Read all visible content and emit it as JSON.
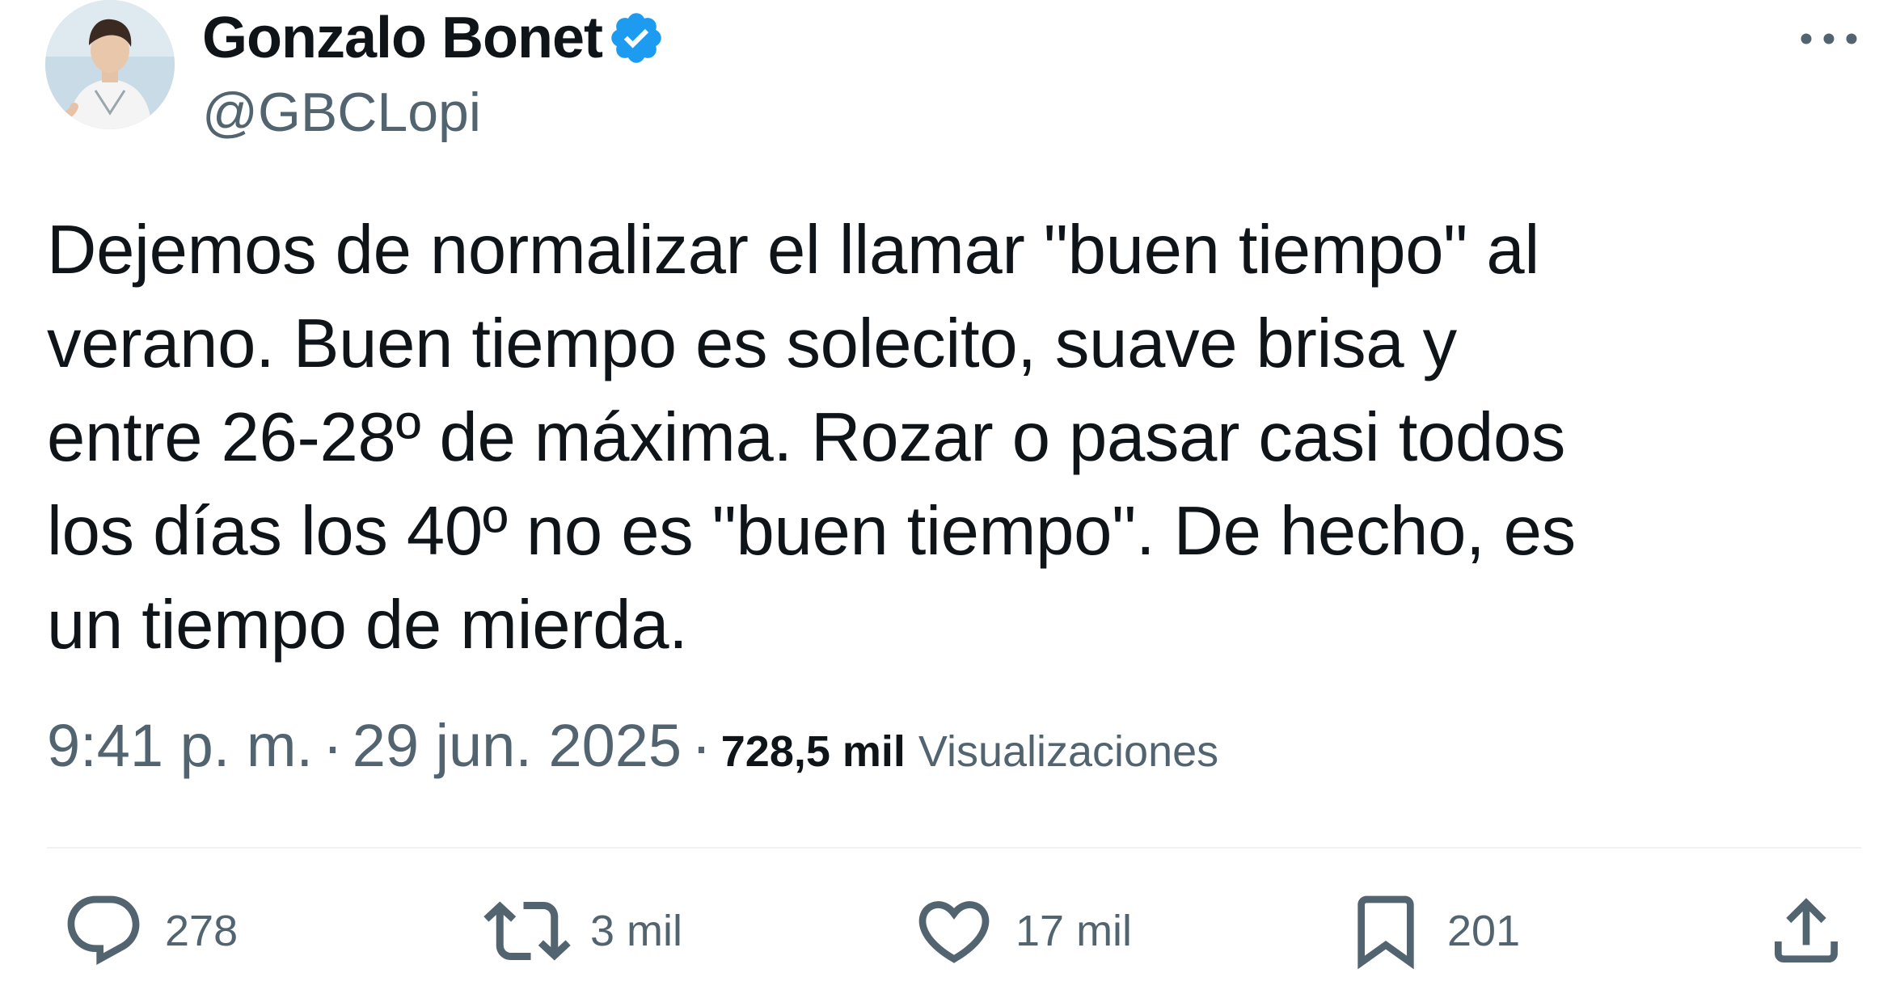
{
  "author": {
    "display_name": "Gonzalo Bonet",
    "handle": "@GBCLopi",
    "verified": true,
    "avatar_icon": "profile-photo",
    "verified_color": "#1d9bf0"
  },
  "tweet": {
    "text": "Dejemos de normalizar el llamar \"buen tiempo\" al\nverano. Buen tiempo es solecito, suave brisa y\nentre 26-28º de máxima. Rozar o pasar casi todos\nlos días los 40º no es \"buen tiempo\". De hecho, es\nun tiempo de mierda.",
    "time": "9:41 p. m.",
    "date": "29 jun. 2025",
    "separator": "·",
    "views_count": "728,5 mil",
    "views_label": "Visualizaciones"
  },
  "actions": {
    "reply": {
      "icon": "reply-icon",
      "count": "278"
    },
    "retweet": {
      "icon": "retweet-icon",
      "count": "3 mil"
    },
    "like": {
      "icon": "heart-icon",
      "count": "17 mil"
    },
    "bookmark": {
      "icon": "bookmark-icon",
      "count": "201"
    },
    "share": {
      "icon": "share-icon"
    }
  },
  "colors": {
    "text_primary": "#0f1419",
    "text_secondary": "#536471",
    "divider": "#eff3f4"
  }
}
